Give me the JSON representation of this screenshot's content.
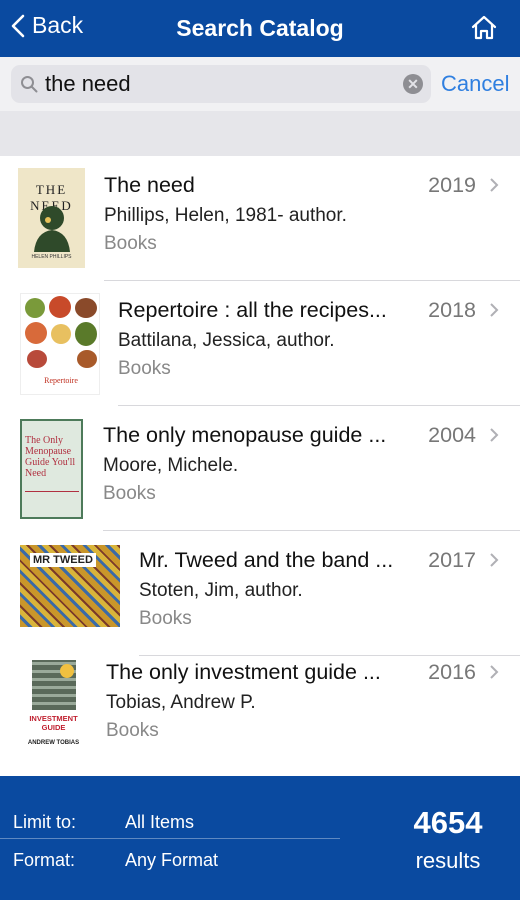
{
  "nav": {
    "back_label": "Back",
    "title": "Search Catalog",
    "home_icon": "home-icon"
  },
  "search": {
    "value": "the need",
    "placeholder": "Search",
    "cancel_label": "Cancel"
  },
  "results": [
    {
      "title": "The need",
      "year": "2019",
      "author": "Phillips, Helen, 1981- author.",
      "type": "Books",
      "cover_text": "THE NEED",
      "cover_author": "HELEN PHILLIPS"
    },
    {
      "title": "Repertoire : all the recipes...",
      "year": "2018",
      "author": "Battilana, Jessica, author.",
      "type": "Books",
      "cover_text": "Repertoire"
    },
    {
      "title": "The only menopause guide ...",
      "year": "2004",
      "author": "Moore, Michele.",
      "type": "Books",
      "cover_text": "The Only Menopause Guide You'll Need"
    },
    {
      "title": "Mr. Tweed and the band ...",
      "year": "2017",
      "author": "Stoten, Jim, author.",
      "type": "Books",
      "cover_text": "MR TWEED"
    },
    {
      "title": "The only investment guide ...",
      "year": "2016",
      "author": "Tobias, Andrew P.",
      "type": "Books",
      "cover_text": "INVESTMENT GUIDE",
      "cover_author": "ANDREW TOBIAS"
    }
  ],
  "footer": {
    "limit_label": "Limit to:",
    "limit_value": "All Items",
    "format_label": "Format:",
    "format_value": "Any Format",
    "count": "4654",
    "results_label": "results"
  },
  "colors": {
    "brand": "#0a4aa0",
    "link": "#2f7fe0"
  }
}
